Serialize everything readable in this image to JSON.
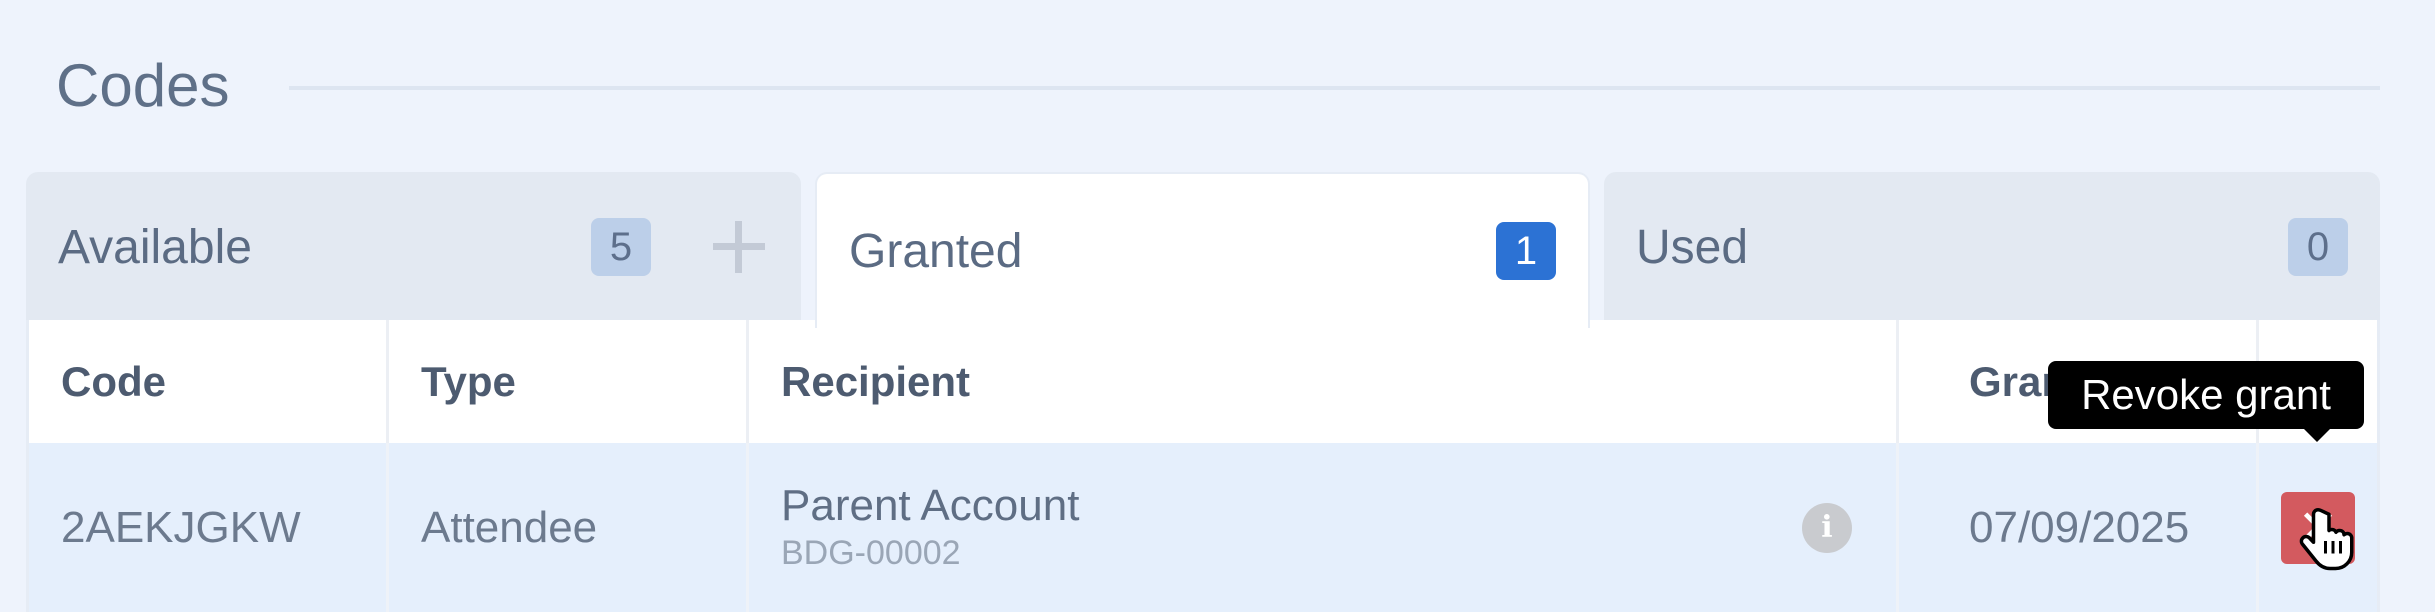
{
  "section": {
    "title": "Codes"
  },
  "tabs": [
    {
      "label": "Available",
      "count": "5",
      "active": false
    },
    {
      "label": "Granted",
      "count": "1",
      "active": true
    },
    {
      "label": "Used",
      "count": "0",
      "active": false
    }
  ],
  "table": {
    "columns": [
      "Code",
      "Type",
      "Recipient",
      "Granted",
      ""
    ],
    "rows": [
      {
        "code": "2AEKJGKW",
        "type": "Attendee",
        "recipient_name": "Parent Account",
        "recipient_id": "BDG-00002",
        "granted": "07/09/2025"
      }
    ]
  },
  "tooltip": {
    "text": "Revoke grant"
  },
  "icons": {
    "add": "plus-icon",
    "info": "info-icon",
    "revoke": "close-icon",
    "cursor": "hand-pointer-icon"
  },
  "colors": {
    "page_background": "#eef3fc",
    "active_badge": "#2c72d4",
    "inactive_badge": "#bccfe9",
    "selected_row": "#e5effc",
    "revoke_button": "#d35a5f"
  }
}
